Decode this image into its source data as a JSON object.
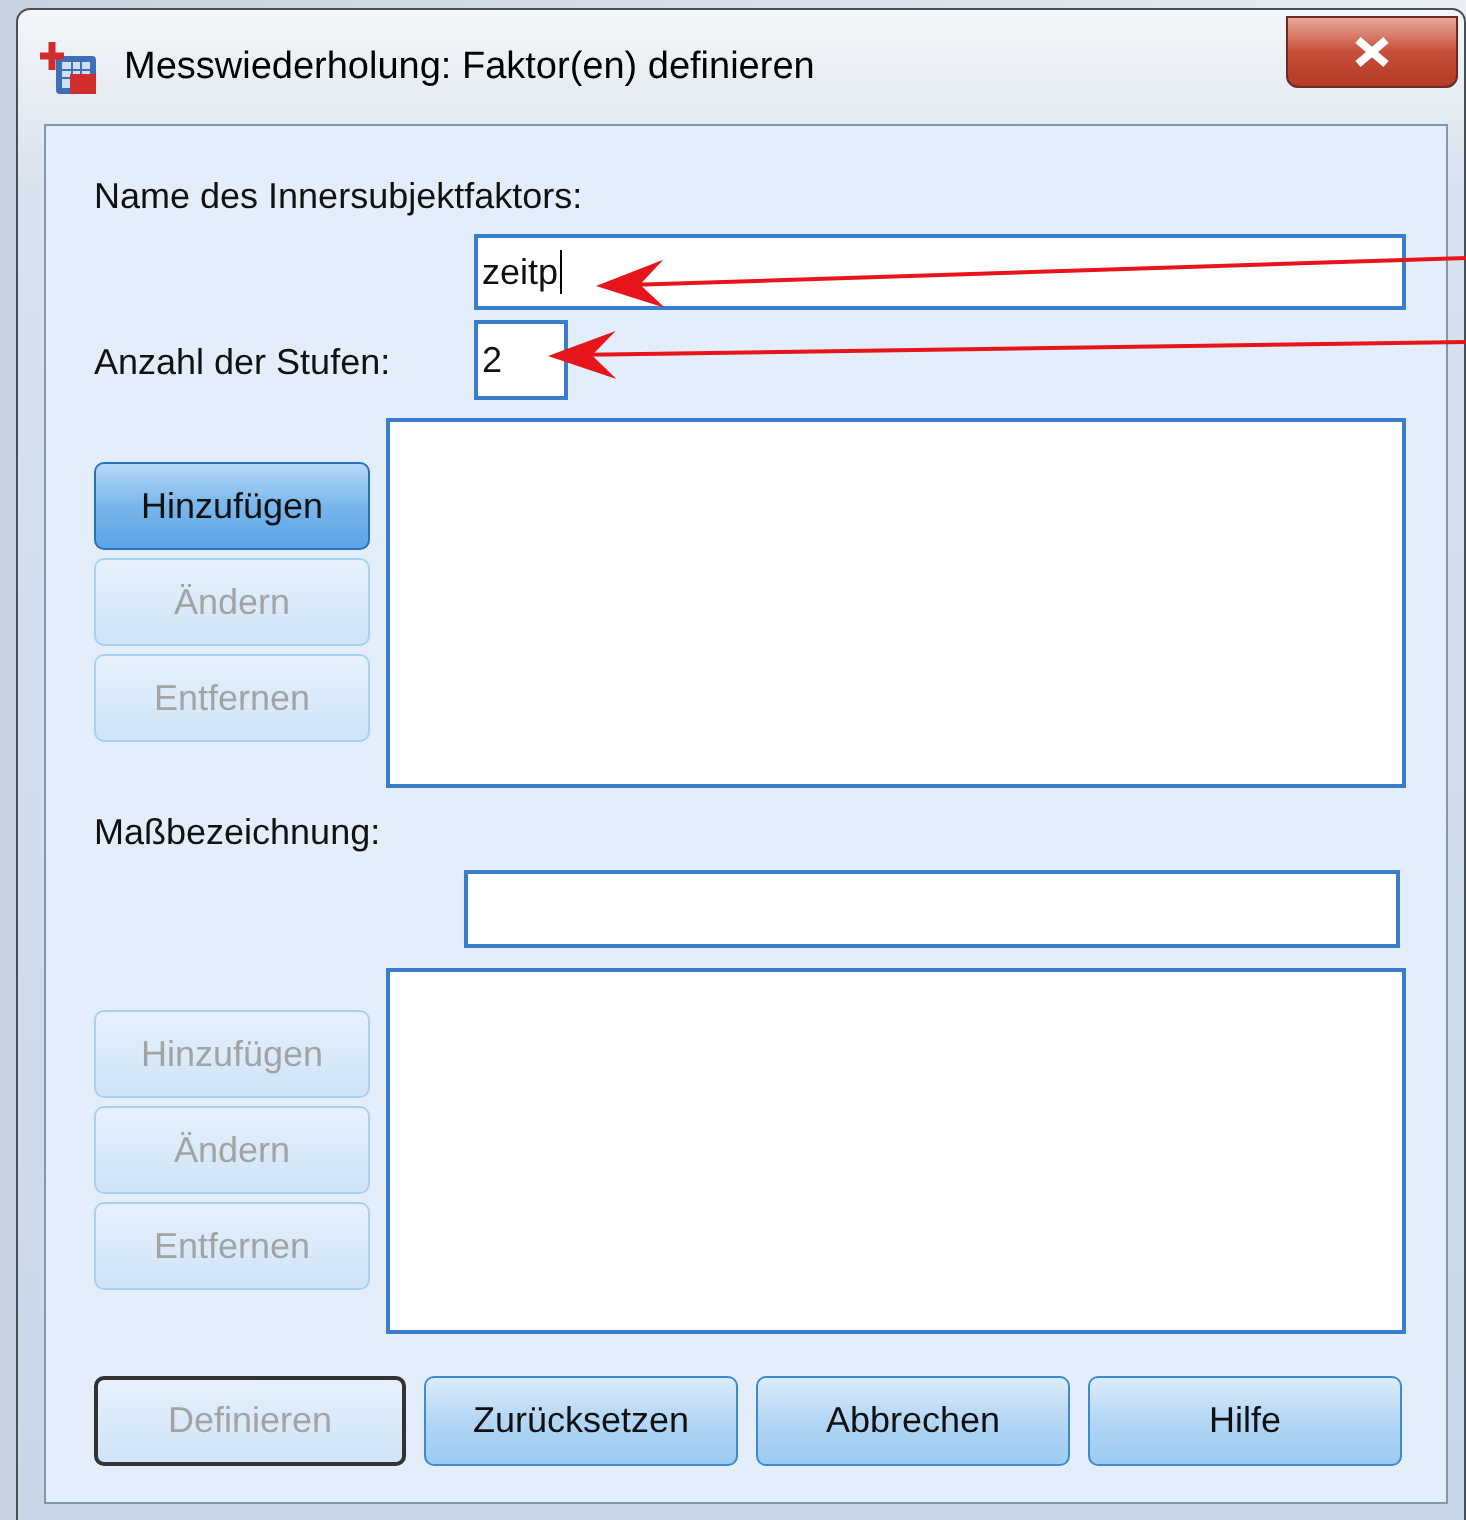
{
  "window": {
    "title": "Messwiederholung: Faktor(en) definieren"
  },
  "factor": {
    "name_label": "Name des Innersubjektfaktors:",
    "name_field": {
      "value": "zeitp",
      "focused": true
    },
    "levels_label": "Anzahl der Stufen:",
    "levels_field": {
      "value": "2",
      "focused": false
    },
    "buttons": [
      {
        "label": "Hinzufügen",
        "disabled": false,
        "focused": true
      },
      {
        "label": "Ändern",
        "disabled": true,
        "focused": false
      },
      {
        "label": "Entfernen",
        "disabled": true,
        "focused": false
      }
    ]
  },
  "measure": {
    "label": "Maßbezeichnung:",
    "buttons": [
      {
        "label": "Hinzufügen",
        "disabled": true,
        "focused": false
      },
      {
        "label": "Ändern",
        "disabled": true,
        "focused": false
      },
      {
        "label": "Entfernen",
        "disabled": true,
        "focused": false
      }
    ]
  },
  "buttons": [
    {
      "label": "Definieren",
      "disabled": true,
      "default": true
    },
    {
      "label": "Zurücksetzen",
      "disabled": false,
      "default": false
    },
    {
      "label": "Abbrechen",
      "disabled": false,
      "default": false
    },
    {
      "label": "Hilfe",
      "disabled": false,
      "default": false
    }
  ],
  "annotations": [
    {
      "kind": "arrow"
    },
    {
      "kind": "arrow"
    }
  ]
}
